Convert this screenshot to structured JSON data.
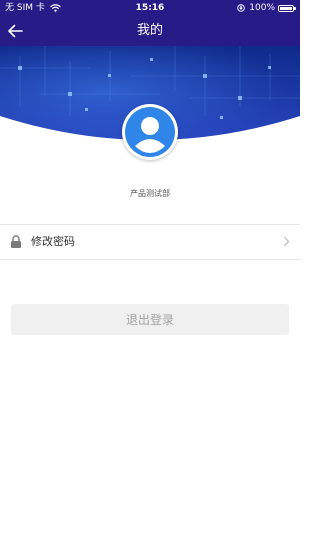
{
  "status_bar": {
    "carrier": "无 SIM 卡",
    "time": "15:16",
    "battery_text": "100%",
    "battery_level": 1.0
  },
  "nav": {
    "title": "我的",
    "back_icon": "arrow-left-icon"
  },
  "profile": {
    "avatar_icon": "user-avatar-icon",
    "department": "产品测试部"
  },
  "menu": {
    "items": [
      {
        "label": "修改密码",
        "icon": "lock-icon",
        "chevron": "chevron-right-icon"
      }
    ]
  },
  "actions": {
    "logout_label": "退出登录"
  },
  "colors": {
    "header": "#271b87",
    "banner_deep": "#1f3aa8",
    "avatar_blue": "#2f86e8",
    "logout_bg": "#f0f0f0",
    "logout_text": "#a3a3a3"
  }
}
